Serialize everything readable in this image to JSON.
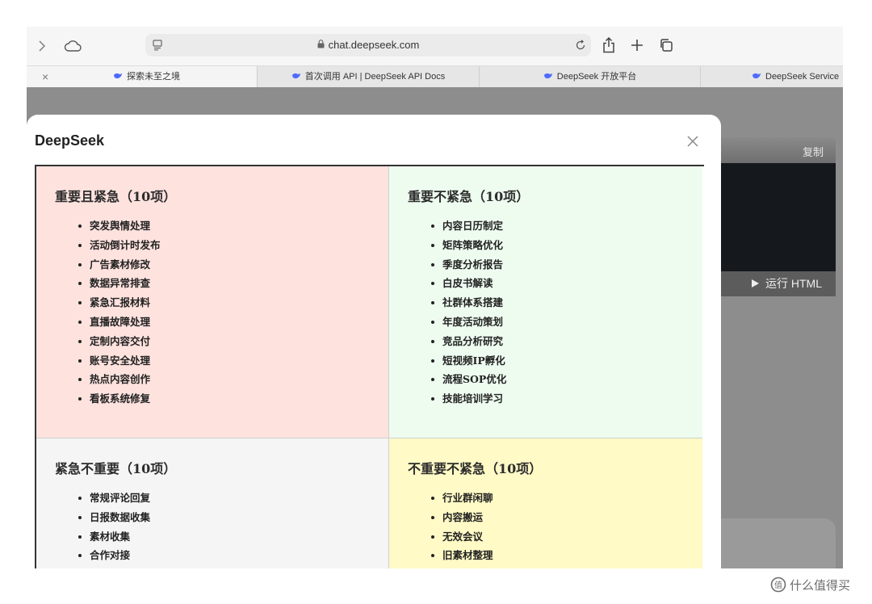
{
  "browser": {
    "url": "chat.deepseek.com",
    "tabs": [
      {
        "label": "探索未至之境",
        "active": true
      },
      {
        "label": "首次调用 API | DeepSeek API Docs",
        "active": false
      },
      {
        "label": "DeepSeek 开放平台",
        "active": false
      },
      {
        "label": "DeepSeek Service",
        "active": false
      }
    ],
    "tab_close": "×"
  },
  "background_panel": {
    "copy_label": "复制",
    "run_label": "运行 HTML"
  },
  "modal": {
    "title": "DeepSeek",
    "quadrants": [
      {
        "title": "重要且紧急（10项）",
        "color": "#fde2de",
        "items": [
          "突发舆情处理",
          "活动倒计时发布",
          "广告素材修改",
          "数据异常排查",
          "紧急汇报材料",
          "直播故障处理",
          "定制内容交付",
          "账号安全处理",
          "热点内容创作",
          "看板系统修复"
        ]
      },
      {
        "title": "重要不紧急（10项）",
        "color": "#eefcf0",
        "items": [
          "内容日历制定",
          "矩阵策略优化",
          "季度分析报告",
          "白皮书解读",
          "社群体系搭建",
          "年度活动策划",
          "竞品分析研究",
          "短视频IP孵化",
          "流程SOP优化",
          "技能培训学习"
        ]
      },
      {
        "title": "紧急不重要（10项）",
        "color": "#f5f5f5",
        "items": [
          "常规评论回复",
          "日报数据收集",
          "素材收集",
          "合作对接"
        ]
      },
      {
        "title": "不重要不紧急（10项）",
        "color": "#fffac6",
        "items": [
          "行业群闲聊",
          "内容搬运",
          "无效会议",
          "旧素材整理"
        ]
      }
    ]
  },
  "watermark": "什么值得买"
}
